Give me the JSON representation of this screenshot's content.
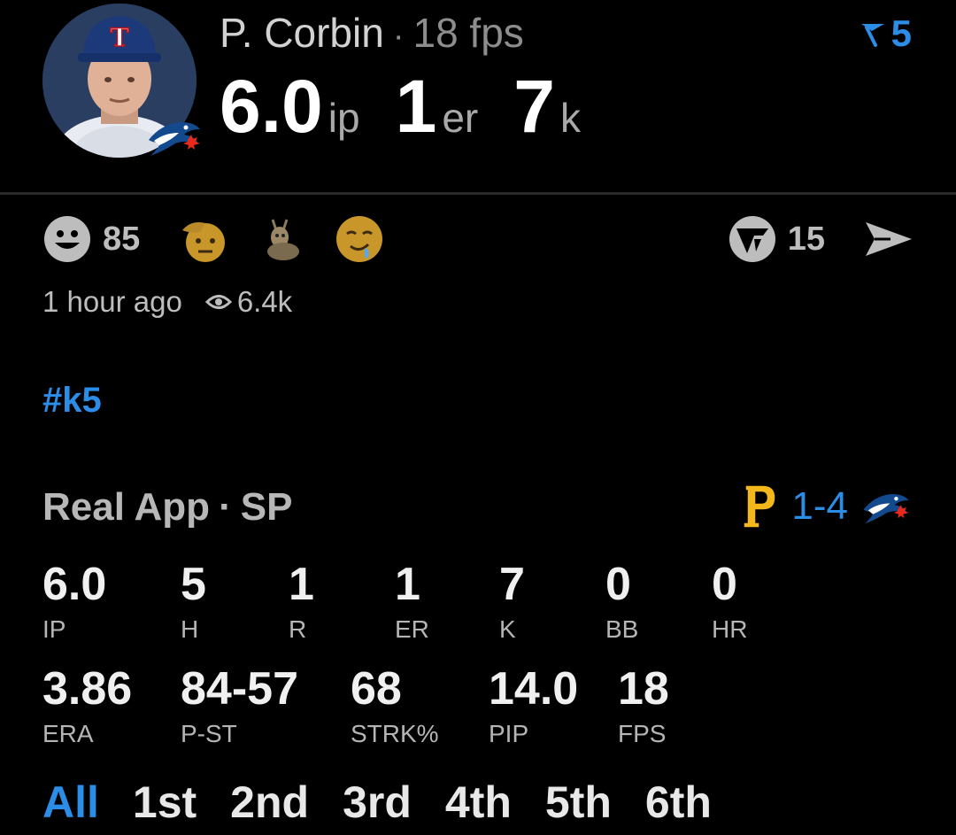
{
  "player": {
    "name": "P. Corbin",
    "separator": "·",
    "fps_label": "18 fps",
    "ip_value": "6.0",
    "ip_unit": "ip",
    "er_value": "1",
    "er_unit": "er",
    "k_value": "7",
    "k_unit": "k",
    "rank": "5"
  },
  "reactions": {
    "smile_count": "85",
    "share_count": "15"
  },
  "meta": {
    "time_ago": "1 hour ago",
    "views": "6.4k"
  },
  "hashtag": "#k5",
  "context": {
    "app": "Real App",
    "dot": "·",
    "role": "SP",
    "score": "1-4"
  },
  "stats_row1": [
    {
      "value": "6.0",
      "label": "IP"
    },
    {
      "value": "5",
      "label": "H"
    },
    {
      "value": "1",
      "label": "R"
    },
    {
      "value": "1",
      "label": "ER"
    },
    {
      "value": "7",
      "label": "K"
    },
    {
      "value": "0",
      "label": "BB"
    },
    {
      "value": "0",
      "label": "HR"
    }
  ],
  "stats_row2": [
    {
      "value": "3.86",
      "label": "ERA"
    },
    {
      "value": "84-57",
      "label": "P-ST"
    },
    {
      "value": "68",
      "label": "STRK%"
    },
    {
      "value": "14.0",
      "label": "PIP"
    },
    {
      "value": "18",
      "label": "FPS"
    }
  ],
  "innings": [
    "All",
    "1st",
    "2nd",
    "3rd",
    "4th",
    "5th",
    "6th"
  ],
  "colors": {
    "accent": "#2c8de7",
    "background": "#000000",
    "divider": "#2a2a2a",
    "pirates_gold": "#f4b81c"
  }
}
